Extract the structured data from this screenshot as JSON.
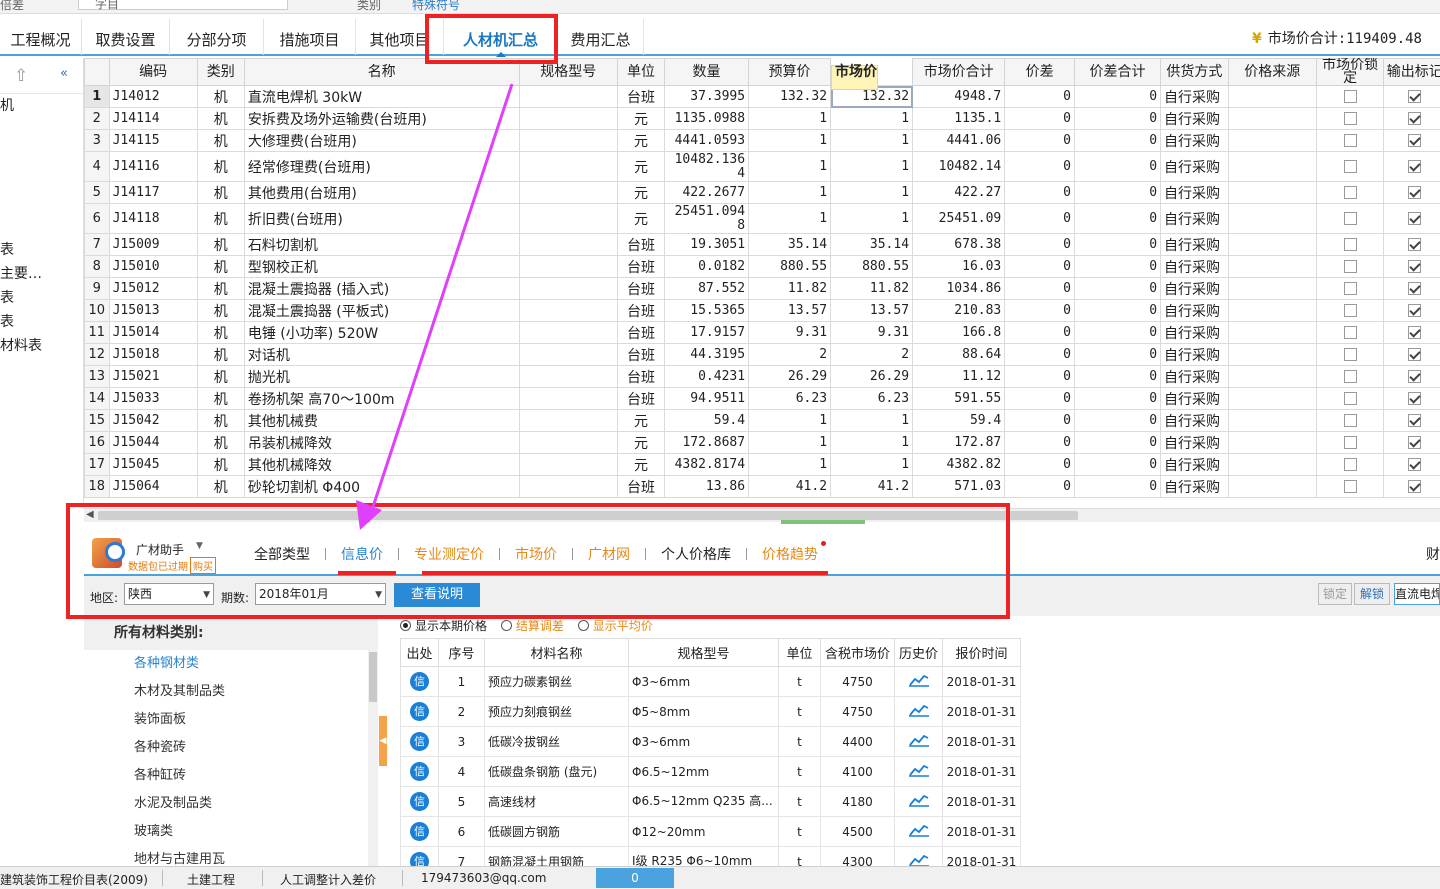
{
  "topstrip": {
    "left_text": "倍差",
    "field_text": "字目",
    "type_label": "类别",
    "type_value": "特殊符号"
  },
  "tabs": [
    {
      "label": "工程概况"
    },
    {
      "label": "取费设置"
    },
    {
      "label": "分部分项"
    },
    {
      "label": "措施项目"
    },
    {
      "label": "其他项目"
    },
    {
      "label": "人材机汇总"
    },
    {
      "label": "费用汇总"
    }
  ],
  "market_total": "市场价合计:119409.48",
  "leftnav": [
    "机",
    "",
    "",
    "",
    "",
    "",
    "表",
    "主要…",
    "表",
    "表",
    "材料表"
  ],
  "grid": {
    "headers": [
      "编码",
      "类别",
      "名称",
      "规格型号",
      "单位",
      "数量",
      "预算价",
      "市场价",
      "市场价合计",
      "价差",
      "价差合计",
      "供货方式",
      "价格来源",
      "市场价锁定",
      "输出标记"
    ],
    "rows": [
      {
        "no": "1",
        "code": "J14012",
        "cat": "机",
        "name": "直流电焊机 30kW",
        "unit": "台班",
        "qty": "37.3995",
        "budget": "132.32",
        "market": "132.32",
        "total": "4948.7",
        "diff": "0",
        "difftotal": "0",
        "supply": "自行采购",
        "lock": false,
        "out": true
      },
      {
        "no": "2",
        "code": "J14114",
        "cat": "机",
        "name": "安拆费及场外运输费(台班用)",
        "unit": "元",
        "qty": "1135.0988",
        "budget": "1",
        "market": "1",
        "total": "1135.1",
        "diff": "0",
        "difftotal": "0",
        "supply": "自行采购",
        "lock": false,
        "out": true
      },
      {
        "no": "3",
        "code": "J14115",
        "cat": "机",
        "name": "大修理费(台班用)",
        "unit": "元",
        "qty": "4441.0593",
        "budget": "1",
        "market": "1",
        "total": "4441.06",
        "diff": "0",
        "difftotal": "0",
        "supply": "自行采购",
        "lock": false,
        "out": true
      },
      {
        "no": "4",
        "code": "J14116",
        "cat": "机",
        "name": "经常修理费(台班用)",
        "unit": "元",
        "qty": "10482.1364",
        "budget": "1",
        "market": "1",
        "total": "10482.14",
        "diff": "0",
        "difftotal": "0",
        "supply": "自行采购",
        "lock": false,
        "out": true
      },
      {
        "no": "5",
        "code": "J14117",
        "cat": "机",
        "name": "其他费用(台班用)",
        "unit": "元",
        "qty": "422.2677",
        "budget": "1",
        "market": "1",
        "total": "422.27",
        "diff": "0",
        "difftotal": "0",
        "supply": "自行采购",
        "lock": false,
        "out": true
      },
      {
        "no": "6",
        "code": "J14118",
        "cat": "机",
        "name": "折旧费(台班用)",
        "unit": "元",
        "qty": "25451.0948",
        "budget": "1",
        "market": "1",
        "total": "25451.09",
        "diff": "0",
        "difftotal": "0",
        "supply": "自行采购",
        "lock": false,
        "out": true
      },
      {
        "no": "7",
        "code": "J15009",
        "cat": "机",
        "name": "石料切割机",
        "unit": "台班",
        "qty": "19.3051",
        "budget": "35.14",
        "market": "35.14",
        "total": "678.38",
        "diff": "0",
        "difftotal": "0",
        "supply": "自行采购",
        "lock": false,
        "out": true
      },
      {
        "no": "8",
        "code": "J15010",
        "cat": "机",
        "name": "型钢校正机",
        "unit": "台班",
        "qty": "0.0182",
        "budget": "880.55",
        "market": "880.55",
        "total": "16.03",
        "diff": "0",
        "difftotal": "0",
        "supply": "自行采购",
        "lock": false,
        "out": true
      },
      {
        "no": "9",
        "code": "J15012",
        "cat": "机",
        "name": "混凝土震捣器 (插入式)",
        "unit": "台班",
        "qty": "87.552",
        "budget": "11.82",
        "market": "11.82",
        "total": "1034.86",
        "diff": "0",
        "difftotal": "0",
        "supply": "自行采购",
        "lock": false,
        "out": true
      },
      {
        "no": "10",
        "code": "J15013",
        "cat": "机",
        "name": "混凝土震捣器 (平板式)",
        "unit": "台班",
        "qty": "15.5365",
        "budget": "13.57",
        "market": "13.57",
        "total": "210.83",
        "diff": "0",
        "difftotal": "0",
        "supply": "自行采购",
        "lock": false,
        "out": true
      },
      {
        "no": "11",
        "code": "J15014",
        "cat": "机",
        "name": "电锤 (小功率) 520W",
        "unit": "台班",
        "qty": "17.9157",
        "budget": "9.31",
        "market": "9.31",
        "total": "166.8",
        "diff": "0",
        "difftotal": "0",
        "supply": "自行采购",
        "lock": false,
        "out": true
      },
      {
        "no": "12",
        "code": "J15018",
        "cat": "机",
        "name": "对话机",
        "unit": "台班",
        "qty": "44.3195",
        "budget": "2",
        "market": "2",
        "total": "88.64",
        "diff": "0",
        "difftotal": "0",
        "supply": "自行采购",
        "lock": false,
        "out": true
      },
      {
        "no": "13",
        "code": "J15021",
        "cat": "机",
        "name": "抛光机",
        "unit": "台班",
        "qty": "0.4231",
        "budget": "26.29",
        "market": "26.29",
        "total": "11.12",
        "diff": "0",
        "difftotal": "0",
        "supply": "自行采购",
        "lock": false,
        "out": true
      },
      {
        "no": "14",
        "code": "J15033",
        "cat": "机",
        "name": "卷扬机架 高70～100m",
        "unit": "台班",
        "qty": "94.9511",
        "budget": "6.23",
        "market": "6.23",
        "total": "591.55",
        "diff": "0",
        "difftotal": "0",
        "supply": "自行采购",
        "lock": false,
        "out": true
      },
      {
        "no": "15",
        "code": "J15042",
        "cat": "机",
        "name": "其他机械费",
        "unit": "元",
        "qty": "59.4",
        "budget": "1",
        "market": "1",
        "total": "59.4",
        "diff": "0",
        "difftotal": "0",
        "supply": "自行采购",
        "lock": false,
        "out": true
      },
      {
        "no": "16",
        "code": "J15044",
        "cat": "机",
        "name": "吊装机械降效",
        "unit": "元",
        "qty": "172.8687",
        "budget": "1",
        "market": "1",
        "total": "172.87",
        "diff": "0",
        "difftotal": "0",
        "supply": "自行采购",
        "lock": false,
        "out": true
      },
      {
        "no": "17",
        "code": "J15045",
        "cat": "机",
        "name": "其他机械降效",
        "unit": "元",
        "qty": "4382.8174",
        "budget": "1",
        "market": "1",
        "total": "4382.82",
        "diff": "0",
        "difftotal": "0",
        "supply": "自行采购",
        "lock": false,
        "out": true
      },
      {
        "no": "18",
        "code": "J15064",
        "cat": "机",
        "name": "砂轮切割机 Φ400",
        "unit": "台班",
        "qty": "13.86",
        "budget": "41.2",
        "market": "41.2",
        "total": "571.03",
        "diff": "0",
        "difftotal": "0",
        "supply": "自行采购",
        "lock": false,
        "out": true
      }
    ]
  },
  "assistant": {
    "title": "广材助手",
    "expired": "数据包已过期",
    "buy": "购买",
    "subtabs": [
      "全部类型",
      "信息价",
      "专业测定价",
      "市场价",
      "广材网",
      "个人价格库",
      "价格趋势"
    ],
    "region_label": "地区:",
    "region_value": "陕西",
    "period_label": "期数:",
    "period_value": "2018年01月",
    "explain_btn": "查看说明",
    "lock_btn": "锁定",
    "unlock_btn": "解锁",
    "apply_btn": "直流电焊",
    "right_edge_text": "财"
  },
  "categories": {
    "header": "所有材料类别:",
    "items": [
      "各种钢材类",
      "木材及其制品类",
      "装饰面板",
      "各种瓷砖",
      "各种缸砖",
      "水泥及制品类",
      "玻璃类",
      "地材与古建用瓦"
    ]
  },
  "price_options": [
    "显示本期价格",
    "结算调差",
    "显示平均价"
  ],
  "price_table": {
    "headers": [
      "出处",
      "序号",
      "材料名称",
      "规格型号",
      "单位",
      "含税市场价",
      "历史价",
      "报价时间"
    ],
    "source_icon": "信",
    "rows": [
      {
        "no": "1",
        "name": "预应力碳素钢丝",
        "spec": "Φ3~6mm",
        "unit": "t",
        "price": "4750",
        "date": "2018-01-31"
      },
      {
        "no": "2",
        "name": "预应力刻痕钢丝",
        "spec": "Φ5~8mm",
        "unit": "t",
        "price": "4750",
        "date": "2018-01-31"
      },
      {
        "no": "3",
        "name": "低碳冷拔钢丝",
        "spec": "Φ3~6mm",
        "unit": "t",
        "price": "4400",
        "date": "2018-01-31"
      },
      {
        "no": "4",
        "name": "低碳盘条钢筋 (盘元)",
        "spec": "Φ6.5~12mm",
        "unit": "t",
        "price": "4100",
        "date": "2018-01-31"
      },
      {
        "no": "5",
        "name": "高速线材",
        "spec": "Φ6.5~12mm Q235 高...",
        "unit": "t",
        "price": "4180",
        "date": "2018-01-31"
      },
      {
        "no": "6",
        "name": "低碳圆方钢筋",
        "spec": "Φ12~20mm",
        "unit": "t",
        "price": "4500",
        "date": "2018-01-31"
      },
      {
        "no": "7",
        "name": "钢筋混凝土用钢筋",
        "spec": "Ⅰ级 R235 Φ6~10mm",
        "unit": "t",
        "price": "4300",
        "date": "2018-01-31"
      }
    ]
  },
  "statusbar": {
    "items": [
      "建筑装饰工程价目表(2009)",
      "土建工程",
      "人工调整计入差价",
      "179473603@qq.com"
    ],
    "progress": "0"
  },
  "colors": {
    "accent": "#4aa3df",
    "annotation": "#ee2222",
    "arrow": "#e040fb",
    "orange": "#e58a16"
  }
}
